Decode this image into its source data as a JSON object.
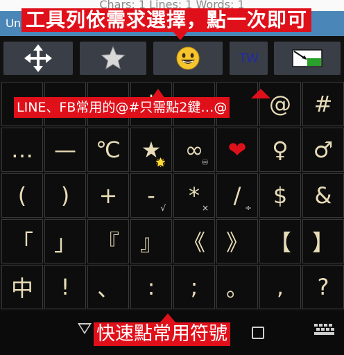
{
  "status_strip": "Chars: 1  Lines: 1  Words: 1",
  "app_title": "Un",
  "callouts": {
    "top": "工具列依需求選擇，點一次即可",
    "middle": "LINE、FB常用的@#只需點2鍵…@",
    "bottom": "快速點常用符號"
  },
  "toolbar": {
    "items": [
      "move-arrows",
      "star",
      "smiley",
      "tw-text",
      "input-switch"
    ],
    "tw_label": "TW",
    "smiley": "😃",
    "star": "★"
  },
  "keys": [
    {
      "label": "-",
      "hint": ""
    },
    {
      "label": "",
      "hint": ""
    },
    {
      "label": "",
      "hint": ""
    },
    {
      "label": "|",
      "hint": ""
    },
    {
      "label": "",
      "hint": ""
    },
    {
      "label": "",
      "hint": ""
    },
    {
      "label": "@",
      "hint": ""
    },
    {
      "label": "#",
      "hint": ""
    },
    {
      "label": "…",
      "hint": ""
    },
    {
      "label": "—",
      "hint": ""
    },
    {
      "label": "℃",
      "hint": ""
    },
    {
      "label": "★",
      "hint": "🌟"
    },
    {
      "label": "∞",
      "hint": "♾"
    },
    {
      "label": "❤",
      "hint": ""
    },
    {
      "label": "♀",
      "hint": ""
    },
    {
      "label": "♂",
      "hint": ""
    },
    {
      "label": "(",
      "hint": ""
    },
    {
      "label": ")",
      "hint": ""
    },
    {
      "label": "+",
      "hint": ""
    },
    {
      "label": "-",
      "hint": "√"
    },
    {
      "label": "*",
      "hint": "×"
    },
    {
      "label": "/",
      "hint": "÷"
    },
    {
      "label": "$",
      "hint": ""
    },
    {
      "label": "&",
      "hint": ""
    },
    {
      "label": "「",
      "hint": ""
    },
    {
      "label": "」",
      "hint": ""
    },
    {
      "label": "『",
      "hint": ""
    },
    {
      "label": "』",
      "hint": ""
    },
    {
      "label": "《",
      "hint": ""
    },
    {
      "label": "》",
      "hint": ""
    },
    {
      "label": "【",
      "hint": ""
    },
    {
      "label": "】",
      "hint": ""
    },
    {
      "label": "中",
      "hint": ""
    },
    {
      "label": "!",
      "hint": ""
    },
    {
      "label": "、",
      "hint": ""
    },
    {
      "label": ":",
      "hint": ""
    },
    {
      "label": ";",
      "hint": ""
    },
    {
      "label": "。",
      "hint": ""
    },
    {
      "label": ",",
      "hint": ""
    },
    {
      "label": "?",
      "hint": ""
    }
  ],
  "colors": {
    "key_text": "#e8dcb8",
    "callout": "#e0101a",
    "heart": "#e0101a",
    "star_key": "#e8dcb8",
    "tw": "#1e2aa8"
  }
}
